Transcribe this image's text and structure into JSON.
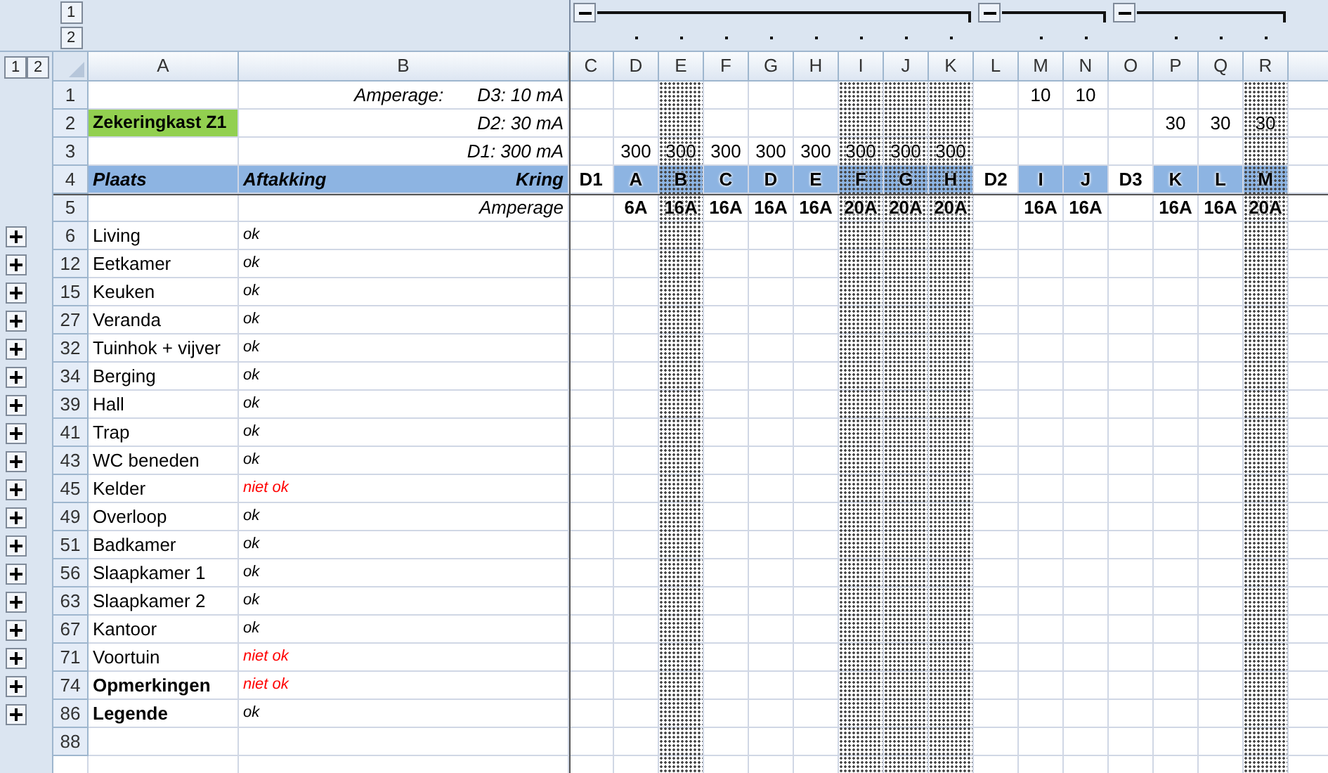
{
  "outline_levels": {
    "columns": [
      "1",
      "2"
    ],
    "rows": [
      "1",
      "2"
    ]
  },
  "columns": [
    {
      "letter": "A",
      "shaded": false,
      "kind": "plain"
    },
    {
      "letter": "B",
      "shaded": false,
      "kind": "plain"
    },
    {
      "letter": "C",
      "shaded": false,
      "kind": "toggle",
      "expanded": true
    },
    {
      "letter": "D",
      "shaded": false,
      "kind": "detail"
    },
    {
      "letter": "E",
      "shaded": true,
      "kind": "detail"
    },
    {
      "letter": "F",
      "shaded": false,
      "kind": "detail"
    },
    {
      "letter": "G",
      "shaded": false,
      "kind": "detail"
    },
    {
      "letter": "H",
      "shaded": false,
      "kind": "detail"
    },
    {
      "letter": "I",
      "shaded": true,
      "kind": "detail"
    },
    {
      "letter": "J",
      "shaded": true,
      "kind": "detail"
    },
    {
      "letter": "K",
      "shaded": true,
      "kind": "detail"
    },
    {
      "letter": "L",
      "shaded": false,
      "kind": "toggle",
      "expanded": true
    },
    {
      "letter": "M",
      "shaded": false,
      "kind": "detail"
    },
    {
      "letter": "N",
      "shaded": false,
      "kind": "detail"
    },
    {
      "letter": "O",
      "shaded": false,
      "kind": "toggle",
      "expanded": true
    },
    {
      "letter": "P",
      "shaded": false,
      "kind": "detail"
    },
    {
      "letter": "Q",
      "shaded": false,
      "kind": "detail"
    },
    {
      "letter": "R",
      "shaded": true,
      "kind": "detail"
    }
  ],
  "rows": [
    {
      "number": "1",
      "kind": "setting",
      "b": {
        "label": "Amperage:",
        "text": "D3: 10 mA",
        "kind": "note"
      },
      "circuits": {
        "M": "10",
        "N": "10"
      }
    },
    {
      "number": "2",
      "kind": "setting",
      "a": {
        "text": "Zekeringkast Z1",
        "kind": "title"
      },
      "b": {
        "text": "D2: 30 mA",
        "kind": "note"
      },
      "circuits": {
        "P": "30",
        "Q": "30",
        "R": "30"
      }
    },
    {
      "number": "3",
      "kind": "setting",
      "b": {
        "text": "D1: 300 mA",
        "kind": "note"
      },
      "circuits": {
        "D": "300",
        "E": "300",
        "F": "300",
        "G": "300",
        "H": "300",
        "I": "300",
        "J": "300",
        "K": "300"
      }
    },
    {
      "number": "4",
      "kind": "header",
      "a": {
        "text": "Plaats",
        "kind": "header"
      },
      "b": {
        "label": "Aftakking",
        "text": "Kring",
        "kind": "header"
      },
      "circuits": {
        "C": "D1",
        "D": "A",
        "E": "B",
        "F": "C",
        "G": "D",
        "H": "E",
        "I": "F",
        "J": "G",
        "K": "H",
        "L": "D2",
        "M": "I",
        "N": "J",
        "O": "D3",
        "P": "K",
        "Q": "L",
        "R": "M"
      }
    },
    {
      "number": "5",
      "kind": "total",
      "b": {
        "text": "Amperage",
        "kind": "note"
      },
      "circuits": {
        "D": "6A",
        "E": "16A",
        "F": "16A",
        "G": "16A",
        "H": "16A",
        "I": "20A",
        "J": "20A",
        "K": "20A",
        "M": "16A",
        "N": "16A",
        "P": "16A",
        "Q": "16A",
        "R": "20A"
      }
    },
    {
      "number": "6",
      "expanded": false,
      "a": {
        "text": "Living",
        "kind": "plain"
      },
      "b": {
        "text": "ok",
        "kind": "ok"
      }
    },
    {
      "number": "12",
      "expanded": false,
      "a": {
        "text": "Eetkamer",
        "kind": "plain"
      },
      "b": {
        "text": "ok",
        "kind": "ok"
      }
    },
    {
      "number": "15",
      "expanded": false,
      "a": {
        "text": "Keuken",
        "kind": "plain"
      },
      "b": {
        "text": "ok",
        "kind": "ok"
      }
    },
    {
      "number": "27",
      "expanded": false,
      "a": {
        "text": "Veranda",
        "kind": "plain"
      },
      "b": {
        "text": "ok",
        "kind": "ok"
      }
    },
    {
      "number": "32",
      "expanded": false,
      "a": {
        "text": "Tuinhok + vijver",
        "kind": "plain"
      },
      "b": {
        "text": "ok",
        "kind": "ok"
      }
    },
    {
      "number": "34",
      "expanded": false,
      "a": {
        "text": "Berging",
        "kind": "plain"
      },
      "b": {
        "text": "ok",
        "kind": "ok"
      }
    },
    {
      "number": "39",
      "expanded": false,
      "a": {
        "text": "Hall",
        "kind": "plain"
      },
      "b": {
        "text": "ok",
        "kind": "ok"
      }
    },
    {
      "number": "41",
      "expanded": false,
      "a": {
        "text": "Trap",
        "kind": "plain"
      },
      "b": {
        "text": "ok",
        "kind": "ok"
      }
    },
    {
      "number": "43",
      "expanded": false,
      "a": {
        "text": "WC beneden",
        "kind": "plain"
      },
      "b": {
        "text": "ok",
        "kind": "ok"
      }
    },
    {
      "number": "45",
      "expanded": false,
      "a": {
        "text": "Kelder",
        "kind": "plain"
      },
      "b": {
        "text": "niet ok",
        "kind": "fail"
      }
    },
    {
      "number": "49",
      "expanded": false,
      "a": {
        "text": "Overloop",
        "kind": "plain"
      },
      "b": {
        "text": "ok",
        "kind": "ok"
      }
    },
    {
      "number": "51",
      "expanded": false,
      "a": {
        "text": "Badkamer",
        "kind": "plain"
      },
      "b": {
        "text": "ok",
        "kind": "ok"
      }
    },
    {
      "number": "56",
      "expanded": false,
      "a": {
        "text": "Slaapkamer 1",
        "kind": "plain"
      },
      "b": {
        "text": "ok",
        "kind": "ok"
      }
    },
    {
      "number": "63",
      "expanded": false,
      "a": {
        "text": "Slaapkamer 2",
        "kind": "plain"
      },
      "b": {
        "text": "ok",
        "kind": "ok"
      }
    },
    {
      "number": "67",
      "expanded": false,
      "a": {
        "text": "Kantoor",
        "kind": "plain"
      },
      "b": {
        "text": "ok",
        "kind": "ok"
      }
    },
    {
      "number": "71",
      "expanded": false,
      "a": {
        "text": "Voortuin",
        "kind": "plain"
      },
      "b": {
        "text": "niet ok",
        "kind": "fail"
      }
    },
    {
      "number": "74",
      "expanded": false,
      "a": {
        "text": "Opmerkingen",
        "kind": "bold"
      },
      "b": {
        "text": "niet ok",
        "kind": "fail"
      }
    },
    {
      "number": "86",
      "expanded": false,
      "a": {
        "text": "Legende",
        "kind": "bold"
      },
      "b": {
        "text": "ok",
        "kind": "ok"
      }
    },
    {
      "number": "88"
    }
  ]
}
